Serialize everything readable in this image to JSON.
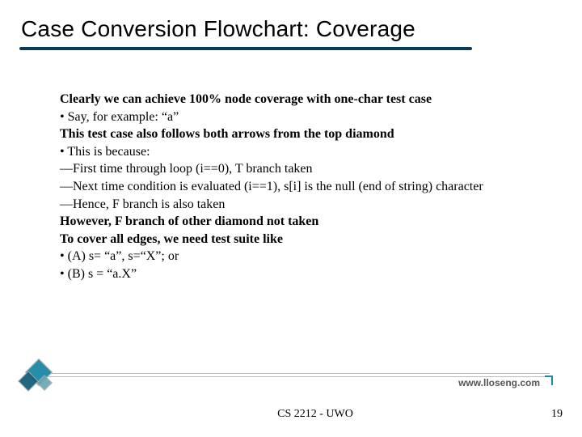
{
  "title": "Case Conversion Flowchart: Coverage",
  "body": {
    "p1": "Clearly we can achieve 100% node coverage with one-char test case",
    "b1": "Say, for example: “a”",
    "p2": "This test case also follows both arrows from the top diamond",
    "b2": "This is because:",
    "d1": "First time through loop (i==0), T branch taken",
    "d2": "Next time condition is evaluated (i==1), s[i] is the null (end of string) character",
    "d3": "Hence, F branch is also taken",
    "p3": "However, F branch of other diamond not taken",
    "p4": "To cover all edges, we need test suite like",
    "b3": "(A) s= “a”, s=“X”; or",
    "b4": "(B) s = “a.X”"
  },
  "footer": {
    "url": "www.lloseng.com",
    "course": "CS 2212 - UWO",
    "page": "19"
  }
}
